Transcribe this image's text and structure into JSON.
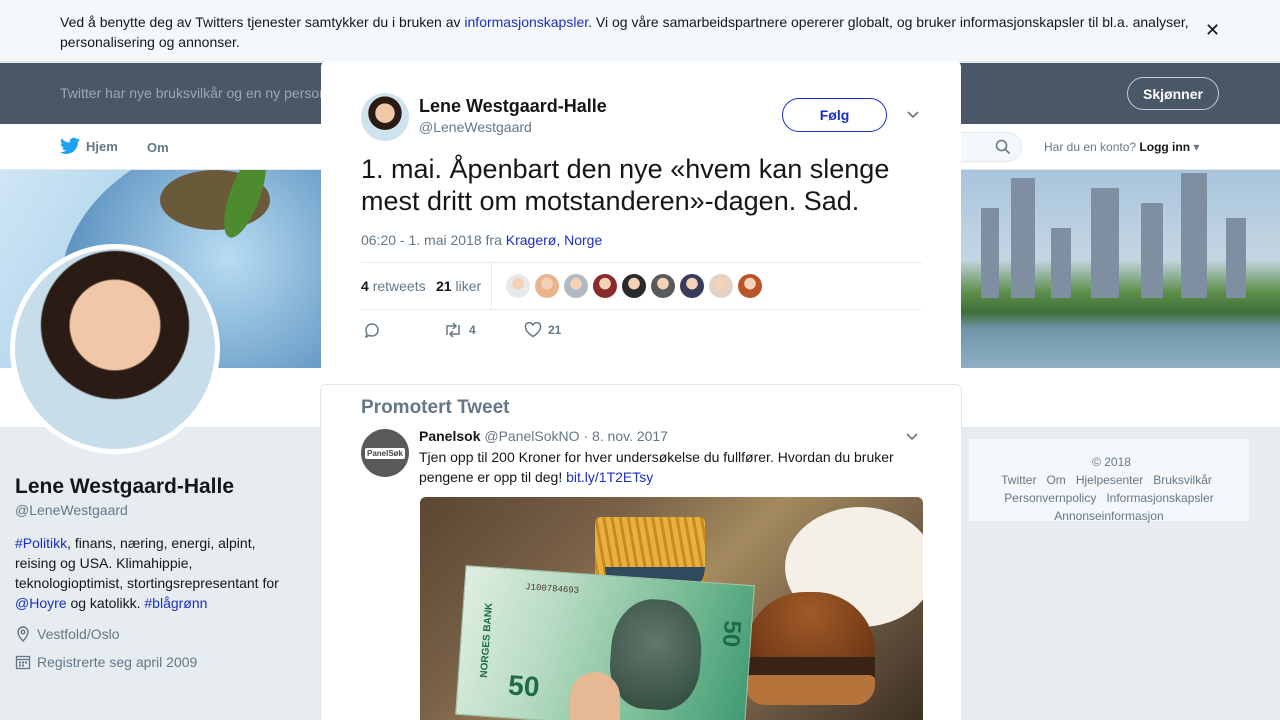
{
  "cookie_banner": {
    "text_before": "Ved å benytte deg av Twitters tjenester samtykker du i bruken av ",
    "link": "informasjonskapsler",
    "text_after": ". Vi og våre samarbeidspartnere opererer globalt, og bruker informasjonskapsler til bl.a. analyser, personalisering og annonser.",
    "close_icon": "close-icon"
  },
  "terms_bar": {
    "text": "Twitter har nye bruksvilkår og en ny person",
    "button": "Skjønner"
  },
  "nav": {
    "home": "Hjem",
    "about": "Om",
    "login_prompt": "Har du en konto?",
    "login": "Logg inn"
  },
  "profile": {
    "name": "Lene Westgaard-Halle",
    "handle": "@LeneWestgaard",
    "bio_hashtag": "#Politikk",
    "bio_text1": ", finans, næring, energi, alpint, reising og USA. Klimahippie, teknologioptimist, stortingsrepresentant for ",
    "bio_mention": "@Hoyre",
    "bio_text2": " og katolikk. ",
    "bio_hashtag2": "#blågrønn",
    "location": "Vestfold/Oslo",
    "joined": "Registrerte seg april 2009"
  },
  "footer": {
    "links": [
      "© 2018 Twitter",
      "Om",
      "Hjelpesenter",
      "Bruksvilkår",
      "Personvernpolicy",
      "Informasjonskapsler",
      "Annonseinformasjon"
    ]
  },
  "tweet": {
    "author_name": "Lene Westgaard-Halle",
    "author_handle": "@LeneWestgaard",
    "follow": "Følg",
    "text": "1. mai. Åpenbart den nye «hvem kan slenge mest dritt om motstanderen»-dagen. Sad.",
    "time": "06:20 - 1. mai 2018 fra ",
    "place": "Kragerø, Norge",
    "retweets_count": "4",
    "retweets_label": "retweets",
    "likes_count": "21",
    "likes_label": "liker",
    "action_retweets": "4",
    "action_likes": "21",
    "liker_colors": [
      "#e8e8e8",
      "#e8b48c",
      "#b0bac4",
      "#8a2c2c",
      "#2a2a2a",
      "#5a5a5a",
      "#3a3a5a",
      "#e6d2c2",
      "#b8542a"
    ]
  },
  "promoted": {
    "title": "Promotert Tweet",
    "avatar_text": "PanelSøk",
    "name": "Panelsok",
    "handle": "@PanelSokNO",
    "date": "· 8. nov. 2017",
    "text": "Tjen opp til 200 Kroner for hver undersøkelse du fullfører. Hvordan du bruker pengene er opp til deg! ",
    "link": "bit.ly/1T2ETsy",
    "note_serial": "J100784693",
    "note_value": "50",
    "note_bank": "NORGES BANK"
  }
}
